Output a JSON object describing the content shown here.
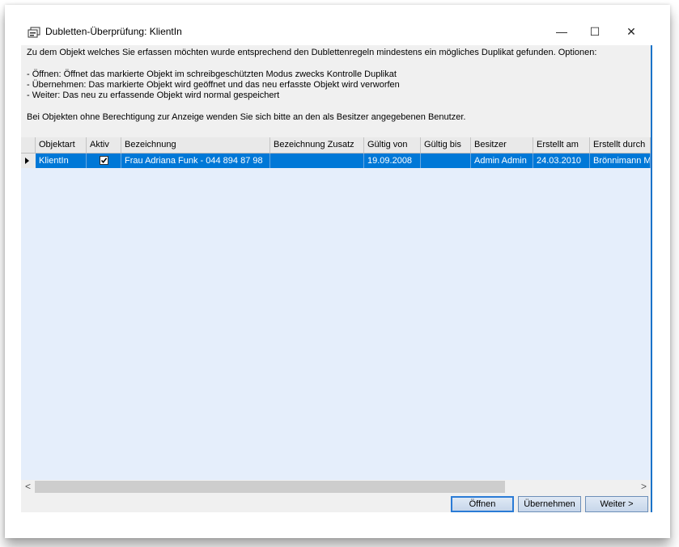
{
  "window": {
    "title": "Dubletten-Überprüfung: KlientIn",
    "icon": "duplicate-check-icon",
    "controls": {
      "minimize": "—",
      "maximize": "☐",
      "close": "✕"
    }
  },
  "message": {
    "line1": "Zu dem Objekt welches Sie erfassen möchten wurde entsprechend den Dublettenregeln mindestens ein mögliches Duplikat gefunden. Optionen:",
    "opt_open": "- Öffnen: Öffnet das markierte Objekt im schreibgeschützten Modus zwecks Kontrolle Duplikat",
    "opt_take": "- Übernehmen: Das markierte Objekt wird geöffnet und das neu erfasste Objekt wird verworfen",
    "opt_next": "- Weiter: Das neu zu erfassende Objekt wird normal gespeichert",
    "note": "Bei Objekten ohne Berechtigung zur Anzeige wenden Sie sich bitte an den als Besitzer angegebenen Benutzer."
  },
  "table": {
    "columns": [
      "Objektart",
      "Aktiv",
      "Bezeichnung",
      "Bezeichnung Zusatz",
      "Gültig von",
      "Gültig bis",
      "Besitzer",
      "Erstellt am",
      "Erstellt durch"
    ],
    "rows": [
      {
        "objektart": "KlientIn",
        "aktiv": true,
        "bezeichnung": "Frau Adriana Funk -  044 894 87 98",
        "bezeichnung_zusatz": "",
        "gueltig_von": "19.09.2008",
        "gueltig_bis": "",
        "besitzer": "Admin Admin",
        "erstellt_am": "24.03.2010",
        "erstellt_durch": "Brönnimann Mic"
      }
    ]
  },
  "scrollbar": {
    "left": "<",
    "right": ">"
  },
  "buttons": {
    "open": "Öffnen",
    "take": "Übernehmen",
    "next": "Weiter >"
  },
  "colors": {
    "selection": "#0078d7",
    "grid_background": "#e5eefb",
    "accent_border": "#1a73c9"
  }
}
